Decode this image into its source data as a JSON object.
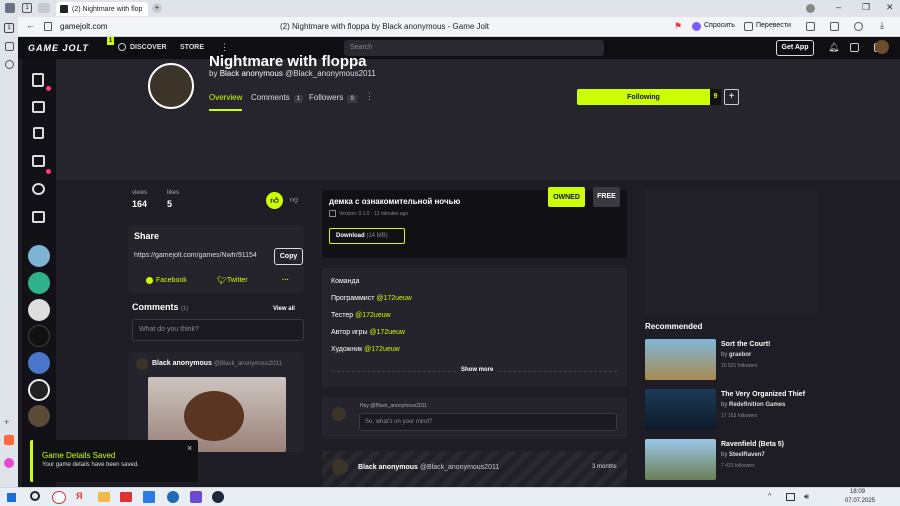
{
  "browser": {
    "tab_count": "1",
    "tab_title": "(2) Nightmare with flop",
    "url": "gamejolt.com",
    "page_title": "(2) Nightmare with floppa by Black anonymous - Game Jolt",
    "ask_label": "Спросить",
    "translate_label": "Перевести",
    "rail_badge": "1"
  },
  "nav": {
    "logo": "GAME JOLT",
    "logo_badge": "1",
    "discover": "DISCOVER",
    "store": "STORE",
    "search_placeholder": "Search",
    "get_app": "Get App"
  },
  "hero": {
    "title": "Nightmare with floppa",
    "byline_prefix": "by",
    "author": "Black anonymous",
    "author_handle": "@Black_anonymous2011",
    "tabs": [
      {
        "label": "Overview"
      },
      {
        "label": "Comments",
        "count": "1"
      },
      {
        "label": "Followers",
        "count": "9"
      }
    ],
    "following_label": "Following",
    "following_count": "9",
    "plus": "+"
  },
  "stats": {
    "views_label": "views",
    "views": "164",
    "likes_label": "likes",
    "likes": "5"
  },
  "share": {
    "heading": "Share",
    "link": "https://gamejolt.com/games/Nwfr/91154",
    "copy": "Copy",
    "facebook": "Facebook",
    "twitter": "Twitter",
    "more": "···"
  },
  "comments": {
    "heading": "Comments",
    "count": "(1)",
    "view_all": "View all",
    "placeholder": "What do you think?",
    "author": "Black anonymous",
    "handle": "@Black_anonymous2011"
  },
  "build": {
    "title": "демка с ознакомительной ночью",
    "version": "Version: 0.1.0  ·  12 minutes ago",
    "download": "Download",
    "size": "(14 MB)",
    "owned": "OWNED",
    "free": "FREE"
  },
  "description": {
    "lines": [
      {
        "text": "Команда",
        "mention": ""
      },
      {
        "text": "Программист ",
        "mention": "@172ueuw"
      },
      {
        "text": "Тестер ",
        "mention": "@172ueuw"
      },
      {
        "text": "Автор игры ",
        "mention": "@172ueuw"
      },
      {
        "text": "Художник ",
        "mention": "@172ueuw"
      }
    ],
    "show_more": "Show more"
  },
  "post_box": {
    "hey": "Hey @Black_anonymous2011",
    "placeholder": "So, what's on your mind?"
  },
  "feed": {
    "author": "Black anonymous",
    "handle": "@Black_anonymous2011",
    "time": "3 months"
  },
  "recommended": {
    "heading": "Recommended",
    "items": [
      {
        "title": "Sort the Court!",
        "by": "by",
        "dev": "graebor",
        "followers": "10 531 followers"
      },
      {
        "title": "The Very Organized Thief",
        "by": "by",
        "dev": "Redefinition Games",
        "followers": "17 163 followers"
      },
      {
        "title": "Ravenfield (Beta 5)",
        "by": "by",
        "dev": "SteelRaven7",
        "followers": "7 431 followers"
      }
    ]
  },
  "toast": {
    "title": "Game Details Saved",
    "body": "Your game details have been saved.",
    "close": "×"
  },
  "taskbar": {
    "time": "18:09",
    "date": "07.07.2025"
  },
  "colors": {
    "accent": "#ccff00",
    "bg": "#1e1c24",
    "card": "#25232b"
  }
}
